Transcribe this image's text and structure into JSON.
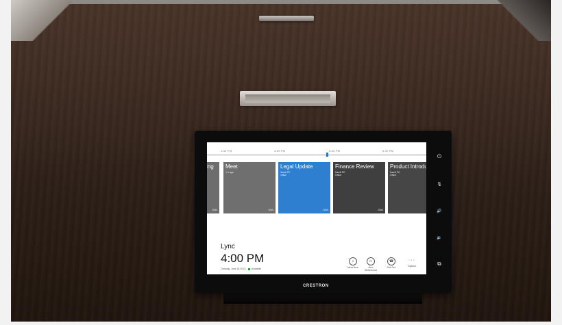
{
  "device": {
    "brand": "CRESTRON",
    "timeline": {
      "ticks": [
        "1:00 PM",
        "4:00 PM",
        "5:00 PM",
        "6:00 PM"
      ]
    },
    "meetings": [
      {
        "title": "ing",
        "sub": "",
        "corner": "JOIN",
        "color": "#6d6d6d"
      },
      {
        "title": "Meet",
        "sub": "1 h ago",
        "corner": "JOIN",
        "color": "#6f6f6f"
      },
      {
        "title": "Legal Update",
        "sub": "Saudi PE\nOffice",
        "corner": "JOIN",
        "color": "#2f7fd0"
      },
      {
        "title": "Finance Review",
        "sub": "Saudi PE\nOffice",
        "corner": "JOIN",
        "color": "#3f3f3f"
      },
      {
        "title": "Product Introdu",
        "sub": "Saudi PE\nOffice",
        "corner": "",
        "color": "#464646"
      }
    ],
    "app_name": "Lync",
    "time": "4:00 PM",
    "date": "Tuesday, June 18 2013",
    "status": "Available",
    "actions": [
      {
        "icon": "search-icon",
        "glyph": "⌕",
        "label": "Meet Now"
      },
      {
        "icon": "whiteboard-icon",
        "glyph": "▭",
        "label": "New\nWhiteboard"
      },
      {
        "icon": "call-icon",
        "glyph": "☎",
        "label": "Dial Out"
      },
      {
        "icon": "more-icon",
        "glyph": "···",
        "label": "Options"
      }
    ],
    "side_buttons": [
      {
        "icon": "power-icon",
        "glyph": "⏻"
      },
      {
        "icon": "mic-mute-icon",
        "glyph": "🎙"
      },
      {
        "icon": "volume-up-icon",
        "glyph": "🔊"
      },
      {
        "icon": "volume-down-icon",
        "glyph": "🔉"
      },
      {
        "icon": "display-icon",
        "glyph": "⧉"
      }
    ],
    "colors": {
      "accent": "#2f7fd0",
      "bezel": "#0c0c0c",
      "status_available": "#2a9d3a"
    }
  }
}
